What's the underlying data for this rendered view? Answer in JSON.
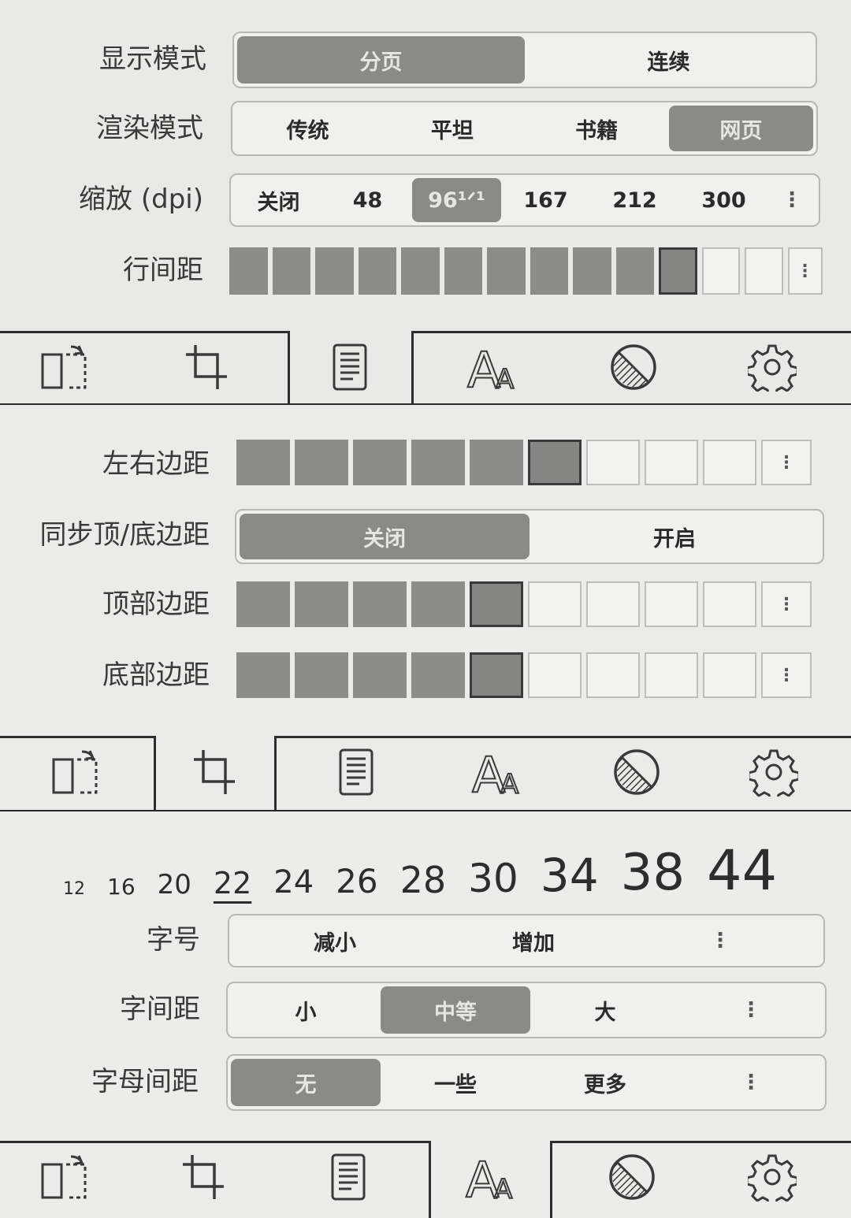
{
  "panel1": {
    "display_mode": {
      "label": "显示模式",
      "options": [
        "分页",
        "连续"
      ],
      "selected": 0
    },
    "render_mode": {
      "label": "渲染模式",
      "options": [
        "传统",
        "平坦",
        "书籍",
        "网页"
      ],
      "selected": 3
    },
    "zoom": {
      "label": "缩放 (dpi)",
      "options": [
        "关闭",
        "48",
        "96¹ᐟ¹",
        "167",
        "212",
        "300"
      ],
      "selected": 2,
      "more": "⋮"
    },
    "line_spacing": {
      "label": "行间距",
      "levels": 13,
      "value": 11,
      "more": "⋮"
    },
    "tabs": [
      "layout-icon",
      "crop-icon",
      "page-icon",
      "font-icon",
      "contrast-icon",
      "gear-icon"
    ]
  },
  "panel2": {
    "lr_margin": {
      "label": "左右边距",
      "levels": 9,
      "value": 6,
      "more": "⋮"
    },
    "sync_margin": {
      "label": "同步顶/底边距",
      "options": [
        "关闭",
        "开启"
      ],
      "selected": 0
    },
    "top_margin": {
      "label": "顶部边距",
      "levels": 9,
      "value": 5,
      "more": "⋮"
    },
    "bottom_margin": {
      "label": "底部边距",
      "levels": 9,
      "value": 5,
      "more": "⋮"
    },
    "tabs": [
      "layout-icon",
      "crop-icon",
      "page-icon",
      "font-icon",
      "contrast-icon",
      "gear-icon"
    ]
  },
  "panel3": {
    "sizes": [
      "12",
      "16",
      "20",
      "22",
      "24",
      "26",
      "28",
      "30",
      "34",
      "38",
      "44"
    ],
    "current_size": "22",
    "font_size": {
      "label": "字号",
      "options": [
        "减小",
        "增加"
      ],
      "more": "⋮"
    },
    "char_spacing": {
      "label": "字间距",
      "options": [
        "小",
        "中等",
        "大"
      ],
      "selected": 1,
      "more": "⋮"
    },
    "letter_spacing": {
      "label": "字母间距",
      "options": [
        "无",
        "一些",
        "更多"
      ],
      "selected": 0,
      "more": "⋮"
    },
    "tabs": [
      "layout-icon",
      "crop-icon",
      "page-icon",
      "font-icon",
      "contrast-icon",
      "gear-icon"
    ]
  },
  "colors": {
    "selected": "#8a8a88",
    "frame": "#2e2e2e",
    "background": "#ebebe9"
  }
}
